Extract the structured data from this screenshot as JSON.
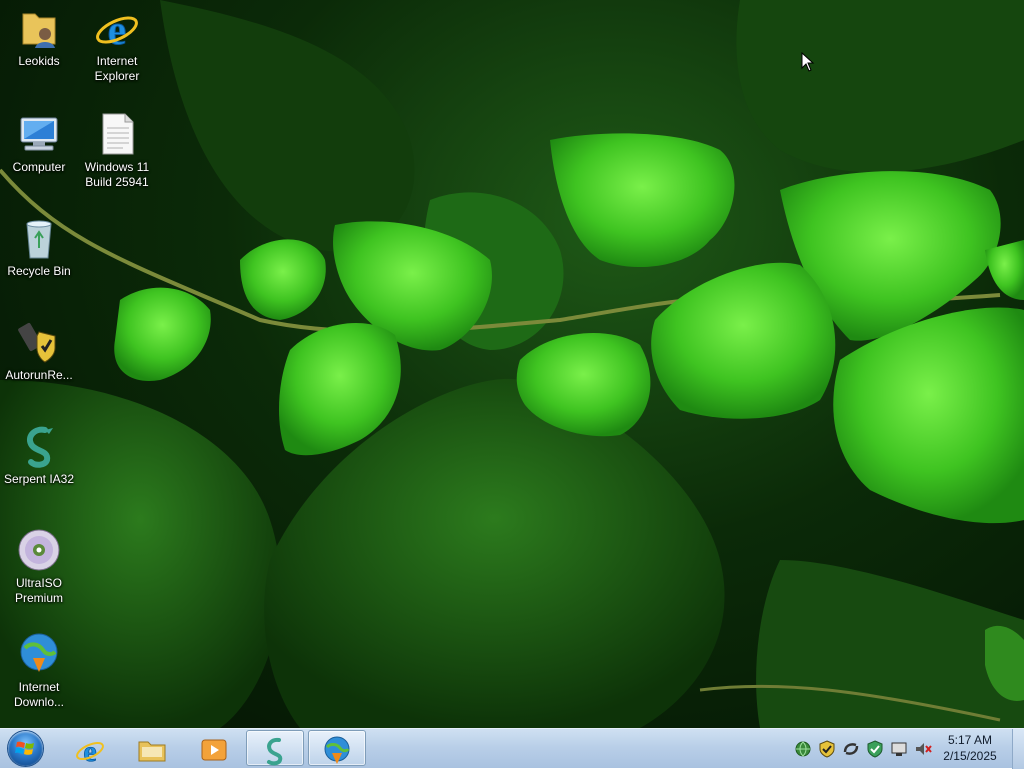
{
  "desktop": {
    "icons": [
      {
        "label": "Leokids",
        "icon": "user-folder-icon"
      },
      {
        "label": "Internet\nExplorer",
        "icon": "internet-explorer-icon"
      },
      {
        "label": "Computer",
        "icon": "computer-icon"
      },
      {
        "label": "Windows 11\nBuild 25941",
        "icon": "text-document-icon"
      },
      {
        "label": "Recycle Bin",
        "icon": "recycle-bin-icon"
      },
      {
        "label": "AutorunRe...",
        "icon": "autorun-shield-icon"
      },
      {
        "label": "Serpent IA32",
        "icon": "serpent-icon"
      },
      {
        "label": "UltraISO\nPremium",
        "icon": "disc-icon"
      },
      {
        "label": "Internet\nDownlo...",
        "icon": "internet-download-manager-icon"
      }
    ]
  },
  "taskbar": {
    "pinned": [
      {
        "name": "internet-explorer-icon"
      },
      {
        "name": "file-explorer-icon"
      },
      {
        "name": "media-player-icon"
      },
      {
        "name": "serpent-icon"
      },
      {
        "name": "internet-download-manager-icon"
      }
    ],
    "tray": {
      "icons": [
        "network-globe-icon",
        "shield-icon",
        "sync-icon",
        "security-check-icon",
        "display-icon",
        "volume-muted-icon"
      ],
      "time": "5:17 AM",
      "date": "2/15/2025"
    }
  },
  "colors": {
    "taskbar": "#b9cfe8",
    "leaf_bright": "#4bd12a",
    "leaf_dark": "#1d5a14"
  }
}
